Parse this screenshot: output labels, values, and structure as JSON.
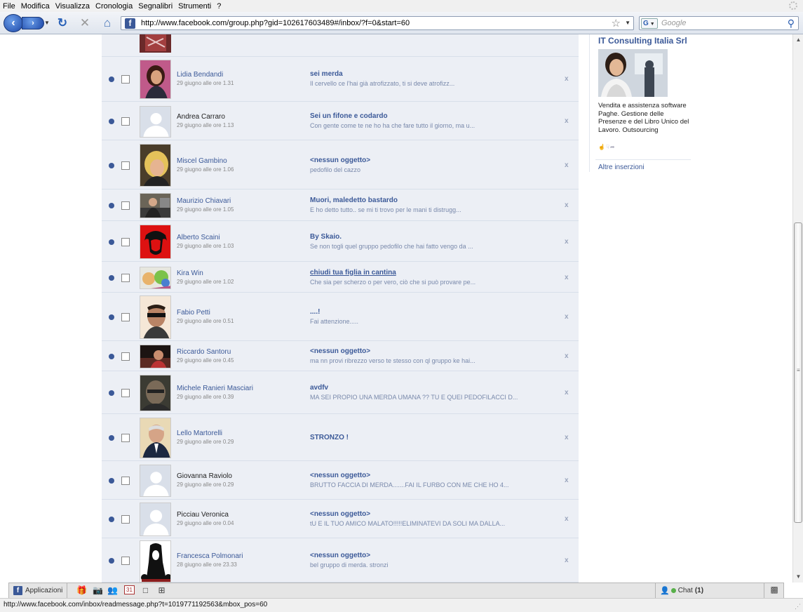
{
  "menu": [
    "File",
    "Modifica",
    "Visualizza",
    "Cronologia",
    "Segnalibri",
    "Strumenti",
    "?"
  ],
  "toolbar": {
    "url": "http://www.facebook.com/group.php?gid=102617603489#/inbox/?f=0&start=60",
    "search_placeholder": "Google",
    "search_engine": "G"
  },
  "messages": [
    {
      "sender": "Lidia Bendandi",
      "time": "29 giugno alle ore 1.31",
      "subject": "sei merda",
      "preview": "Il cervello ce l'hai già atrofizzato, ti si deve atrofizz...",
      "unread": true
    },
    {
      "sender": "Andrea Carraro",
      "time": "29 giugno alle ore 1.13",
      "subject": "Sei un fifone e codardo",
      "preview": "Con gente come te ne ho ha che fare tutto il giorno, ma u...",
      "unread": false
    },
    {
      "sender": "Miscel Gambino",
      "time": "29 giugno alle ore 1.06",
      "subject": "<nessun oggetto>",
      "preview": "pedofilo del cazzo",
      "unread": true
    },
    {
      "sender": "Maurizio Chiavari",
      "time": "29 giugno alle ore 1.05",
      "subject": "Muori, maledetto bastardo",
      "preview": "E ho detto tutto.. se mi ti trovo per le mani ti distrugg...",
      "unread": true
    },
    {
      "sender": "Alberto Scaini",
      "time": "29 giugno alle ore 1.03",
      "subject": "By Skaio.",
      "preview": "Se non togli quel gruppo pedofilo che hai fatto vengo da ...",
      "unread": true
    },
    {
      "sender": "Kira Win",
      "time": "29 giugno alle ore 1.02",
      "subject": "chiudi tua figlia in cantina",
      "preview": "Che sia per scherzo o per vero, ciò che si può provare pe...",
      "unread": true
    },
    {
      "sender": "Fabio Petti",
      "time": "29 giugno alle ore 0.51",
      "subject": "....!",
      "preview": "Fai attenzione.....",
      "unread": true
    },
    {
      "sender": "Riccardo Santoru",
      "time": "29 giugno alle ore 0.45",
      "subject": "<nessun oggetto>",
      "preview": "ma nn provi ribrezzo verso te stesso con ql gruppo ke hai...",
      "unread": true
    },
    {
      "sender": "Michele Ranieri Masciari",
      "time": "29 giugno alle ore 0.39",
      "subject": "avdfv",
      "preview": "MA SEI PROPIO UNA MERDA UMANA ?? TU E QUEI PEDOFILACCI D...",
      "unread": true
    },
    {
      "sender": "Lello Martorelli",
      "time": "29 giugno alle ore 0.29",
      "subject": "STRONZO !",
      "preview": "",
      "unread": true
    },
    {
      "sender": "Giovanna Raviolo",
      "time": "29 giugno alle ore 0.29",
      "subject": "<nessun oggetto>",
      "preview": "BRUTTO FACCIA DI MERDA.......FAI IL FURBO CON ME CHE HO 4...",
      "unread": false
    },
    {
      "sender": "Picciau Veronica",
      "time": "29 giugno alle ore 0.04",
      "subject": "<nessun oggetto>",
      "preview": "tU E IL TUO AMICO MALATO!!!!!ELIMINATEVI DA SOLI MA DALLA...",
      "unread": false
    },
    {
      "sender": "Francesca Polmonari",
      "time": "28 giugno alle ore 23.33",
      "subject": "<nessun oggetto>",
      "preview": "bel gruppo di merda. stronzi",
      "unread": true
    }
  ],
  "delete_label": "x",
  "ad": {
    "title": "IT Consulting Italia Srl",
    "body": "Vendita e assistenza software Paghe. Gestione delle Presenze e del Libro Unico del Lavoro. Outsourcing",
    "more": "Altre inserzioni"
  },
  "fbbar": {
    "apps": "Applicazioni",
    "chat": "Chat",
    "chat_count": "(1)"
  },
  "status": "http://www.facebook.com/inbox/readmessage.php?t=1019771192563&mbox_pos=60",
  "colors": {
    "fb_blue": "#3b5998",
    "inbox_bg": "#eceff5",
    "online": "#58b04a"
  }
}
